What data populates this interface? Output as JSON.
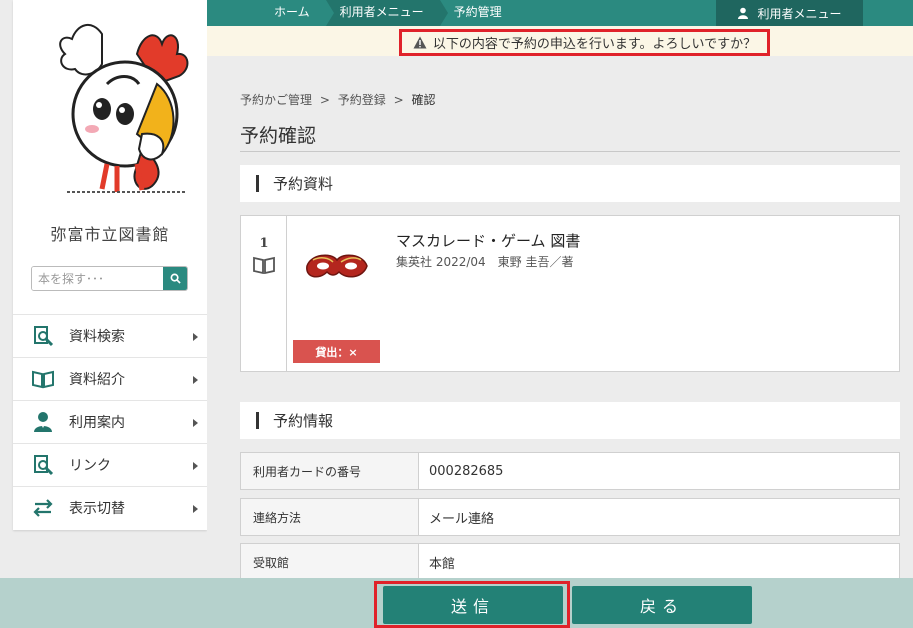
{
  "topnav": {
    "items": [
      "ホーム",
      "利用者メニュー",
      "予約管理"
    ],
    "user_menu": "利用者メニュー"
  },
  "banner": {
    "message": "以下の内容で予約の申込を行います。よろしいですか？",
    "icon": "warning-icon"
  },
  "sidebar": {
    "library_name": "弥富市立図書館",
    "search_placeholder": "本を探す･･･",
    "menu": [
      {
        "label": "資料検索",
        "icon": "search-doc-icon"
      },
      {
        "label": "資料紹介",
        "icon": "open-book-icon"
      },
      {
        "label": "利用案内",
        "icon": "person-icon"
      },
      {
        "label": "リンク",
        "icon": "search-doc-icon"
      },
      {
        "label": "表示切替",
        "icon": "swap-arrows-icon"
      }
    ]
  },
  "breadcrumb": [
    "予約かご管理",
    ">",
    "予約登録",
    ">",
    "確認"
  ],
  "page_title": "予約確認",
  "section_materials": "予約資料",
  "item": {
    "number": "1",
    "title": "マスカレード・ゲーム 図書",
    "meta": "集英社 2022/04　東野 圭吾／著",
    "badge": "貸出：×"
  },
  "section_info": "予約情報",
  "info_rows": [
    {
      "label": "利用者カードの番号",
      "value": "000282685"
    },
    {
      "label": "連絡方法",
      "value": "メール連絡"
    },
    {
      "label": "受取館",
      "value": "本館"
    }
  ],
  "buttons": {
    "send": "送信",
    "back": "戻る"
  },
  "colors": {
    "accent": "#2b8a80",
    "highlight": "#e0222a",
    "badge": "#d9534f"
  }
}
